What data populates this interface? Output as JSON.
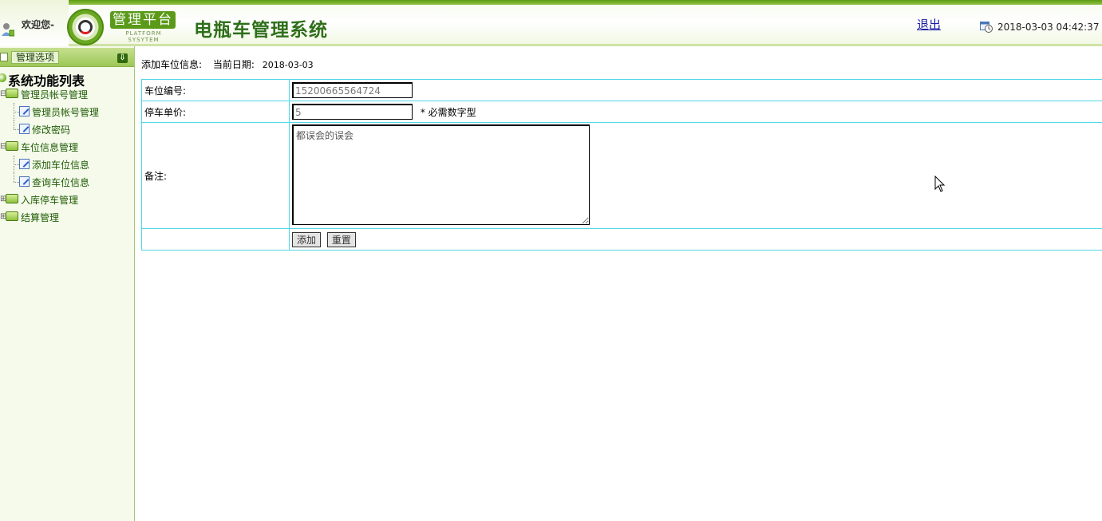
{
  "header": {
    "welcome": "欢迎您-",
    "logo_title": "管理平台",
    "logo_subtitle": "PLATFORM SYSYTEM",
    "system_title": "电瓶车管理系统",
    "logout_label": "退出",
    "datetime": "2018-03-03 04:42:37"
  },
  "sidebar": {
    "header_label": "管理选项",
    "root_label": "系统功能列表",
    "groups": [
      {
        "label": "管理员帐号管理",
        "expanded": true,
        "items": [
          "管理员帐号管理",
          "修改密码"
        ]
      },
      {
        "label": "车位信息管理",
        "expanded": true,
        "items": [
          "添加车位信息",
          "查询车位信息"
        ]
      },
      {
        "label": "入库停车管理",
        "expanded": false,
        "items": []
      },
      {
        "label": "结算管理",
        "expanded": false,
        "items": []
      }
    ]
  },
  "main": {
    "page_title": "添加车位信息:",
    "date_label": "当前日期:",
    "date_value": "2018-03-03",
    "form": {
      "spot_id_label": "车位编号:",
      "spot_id_value": "15200665564724",
      "price_label": "停车单价:",
      "price_value": "5",
      "price_hint": "* 必需数字型",
      "remark_label": "备注:",
      "remark_value": "都误会的误会",
      "add_button": "添加",
      "reset_button": "重置"
    }
  },
  "colors": {
    "accent_green": "#5a9a18",
    "title_green": "#2e6f1a",
    "table_border": "#4fd8e6",
    "link_blue": "#1a1aa6"
  }
}
